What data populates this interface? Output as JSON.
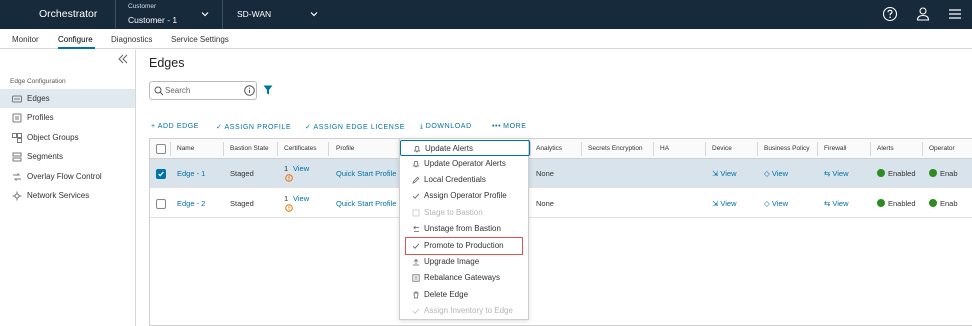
{
  "header": {
    "brand": "Orchestrator",
    "customer_label": "Customer",
    "customer_value": "Customer - 1",
    "product": "SD-WAN",
    "icons": [
      "help-icon",
      "user-icon",
      "menu-icon"
    ]
  },
  "nav": {
    "tabs": [
      {
        "label": "Monitor"
      },
      {
        "label": "Configure"
      },
      {
        "label": "Diagnostics"
      },
      {
        "label": "Service Settings"
      }
    ],
    "active": "Configure"
  },
  "sidebar": {
    "section": "Edge Configuration",
    "items": [
      {
        "label": "Edges",
        "icon": "edge-icon"
      },
      {
        "label": "Profiles",
        "icon": "profiles-icon"
      },
      {
        "label": "Object Groups",
        "icon": "object-groups-icon"
      },
      {
        "label": "Segments",
        "icon": "segments-icon"
      },
      {
        "label": "Overlay Flow Control",
        "icon": "overlay-flow-icon"
      },
      {
        "label": "Network Services",
        "icon": "network-services-icon"
      }
    ],
    "active": "Edges"
  },
  "main": {
    "title": "Edges",
    "search_placeholder": "Search",
    "actions": [
      {
        "label": "ADD EDGE",
        "icon": "+"
      },
      {
        "label": "ASSIGN PROFILE",
        "icon": "✓"
      },
      {
        "label": "ASSIGN EDGE LICENSE",
        "icon": "✓"
      },
      {
        "label": "DOWNLOAD",
        "icon": "⤓"
      },
      {
        "label": "MORE",
        "icon": "•••"
      }
    ]
  },
  "table": {
    "columns": [
      "Name",
      "Bastion State",
      "Certificates",
      "Profile",
      "Analytics",
      "Secrets Encryption",
      "HA",
      "Device",
      "Business Policy",
      "Firewall",
      "Alerts",
      "Operator"
    ],
    "rows": [
      {
        "selected": true,
        "name": "Edge - 1",
        "bastion": "Staged",
        "cert_count": "1",
        "cert_link": "View",
        "profile": "Quick Start Profile",
        "analytics": "None",
        "device": "View",
        "business_policy": "View",
        "firewall": "View",
        "alerts": "Enabled",
        "operator": "Enab"
      },
      {
        "selected": false,
        "name": "Edge - 2",
        "bastion": "Staged",
        "cert_count": "1",
        "cert_link": "View",
        "profile": "Quick Start Profile",
        "analytics": "None",
        "device": "View",
        "business_policy": "View",
        "firewall": "View",
        "alerts": "Enabled",
        "operator": "Enab"
      }
    ]
  },
  "menu": {
    "items": [
      {
        "label": "Update Alerts",
        "icon": "bell-icon",
        "state": "focused"
      },
      {
        "label": "Update Operator Alerts",
        "icon": "bell-icon",
        "state": "normal"
      },
      {
        "label": "Local Credentials",
        "icon": "pencil-icon",
        "state": "normal"
      },
      {
        "label": "Assign Operator Profile",
        "icon": "check-icon",
        "state": "normal"
      },
      {
        "label": "Stage to Bastion",
        "icon": "stage-icon",
        "state": "disabled"
      },
      {
        "label": "Unstage from Bastion",
        "icon": "unstage-icon",
        "state": "normal"
      },
      {
        "label": "Promote to Production",
        "icon": "check-icon",
        "state": "highlighted"
      },
      {
        "label": "Upgrade Image",
        "icon": "upgrade-icon",
        "state": "normal"
      },
      {
        "label": "Rebalance Gateways",
        "icon": "rebalance-icon",
        "state": "normal"
      },
      {
        "label": "Delete Edge",
        "icon": "trash-icon",
        "state": "normal"
      },
      {
        "label": "Assign Inventory to Edge",
        "icon": "check-icon",
        "state": "disabled"
      }
    ]
  },
  "colors": {
    "header_bg": "#172a3c",
    "accent": "#0072a3",
    "selected_row": "#d8e3ec",
    "sidebar_active": "#e1e9f0",
    "ok_green": "#2c8c1f",
    "highlight_red": "#d9534f",
    "warning_orange": "#e57200"
  }
}
